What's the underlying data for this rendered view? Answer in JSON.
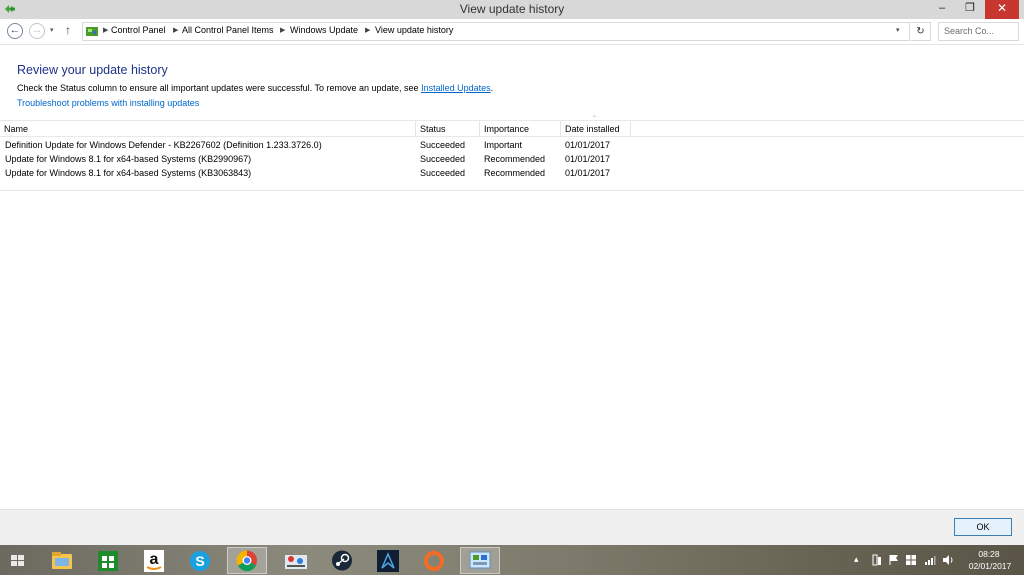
{
  "window": {
    "title": "View update history",
    "minimize_glyph": "–",
    "restore_glyph": "❐",
    "close_glyph": "✕"
  },
  "nav": {
    "back_glyph": "←",
    "forward_glyph": "→",
    "recent_glyph": "▾",
    "up_glyph": "↑",
    "breadcrumb_separator": "▶",
    "breadcrumb": [
      "Control Panel",
      "All Control Panel Items",
      "Windows Update",
      "View update history"
    ],
    "address_dropdown_glyph": "▾",
    "refresh_glyph": "↻",
    "search_placeholder": "Search Co..."
  },
  "content": {
    "heading": "Review your update history",
    "description_prefix": "Check the Status column to ensure all important updates were successful. To remove an update, see ",
    "installed_updates_link": "Installed Updates",
    "description_suffix": ".",
    "troubleshoot_link": "Troubleshoot problems with installing updates"
  },
  "table": {
    "headers": {
      "name": "Name",
      "status": "Status",
      "importance": "Importance",
      "date": "Date installed"
    },
    "sort_glyph": "⌃",
    "rows": [
      {
        "name": "Definition Update for Windows Defender - KB2267602 (Definition 1.233.3726.0)",
        "status": "Succeeded",
        "importance": "Important",
        "date": "01/01/2017"
      },
      {
        "name": "Update for Windows 8.1 for x64-based Systems (KB2990967)",
        "status": "Succeeded",
        "importance": "Recommended",
        "date": "01/01/2017"
      },
      {
        "name": "Update for Windows 8.1 for x64-based Systems (KB3063843)",
        "status": "Succeeded",
        "importance": "Recommended",
        "date": "01/01/2017"
      }
    ]
  },
  "footer": {
    "ok_label": "OK"
  },
  "taskbar": {
    "items": [
      "start-button-icon",
      "file-explorer-icon",
      "windows-store-icon",
      "amazon-icon",
      "skype-icon",
      "chrome-icon",
      "network-map-icon",
      "steam-icon",
      "dark-app-icon",
      "origin-icon",
      "control-panel-icon"
    ],
    "colors": {
      "store": "#1e8c2d",
      "skype": "#1aa1e0",
      "origin": "#f26c23",
      "steam": "#1b2838"
    },
    "tray": {
      "overflow_glyph": "▴",
      "time": "08:28",
      "date": "02/01/2017"
    }
  }
}
